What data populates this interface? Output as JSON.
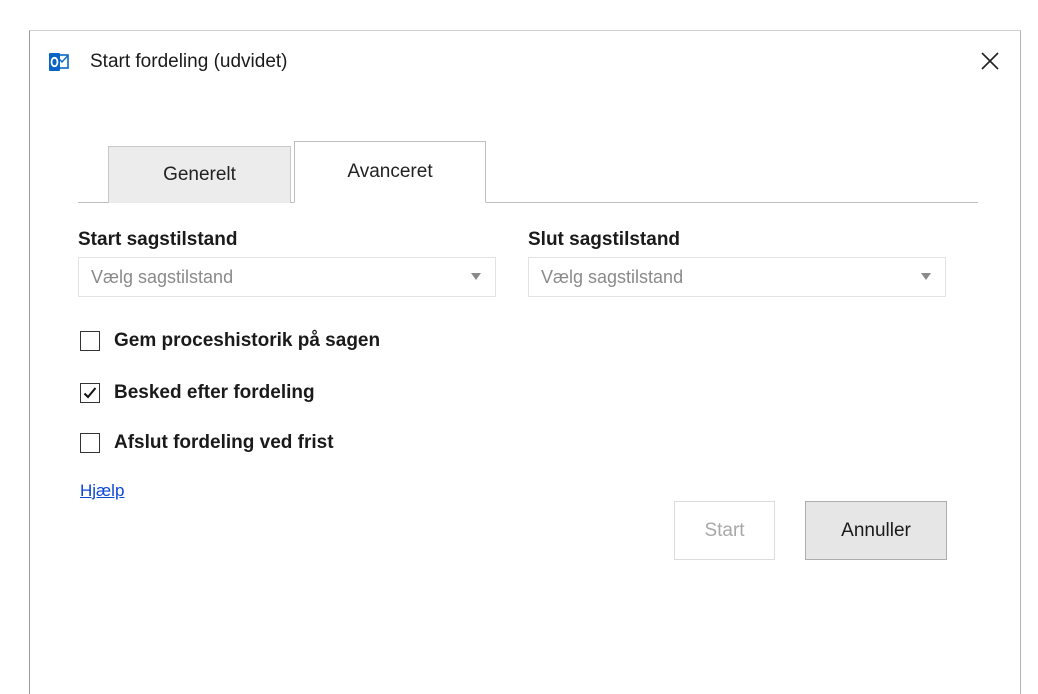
{
  "window": {
    "title": "Start fordeling (udvidet)",
    "app_icon": "outlook-icon",
    "close_icon": "close-icon"
  },
  "tabs": [
    {
      "label": "Generelt",
      "active": false
    },
    {
      "label": "Avanceret",
      "active": true
    }
  ],
  "fields": {
    "start_state": {
      "label": "Start sagstilstand",
      "placeholder": "Vælg sagstilstand"
    },
    "end_state": {
      "label": "Slut sagstilstand",
      "placeholder": "Vælg sagstilstand"
    }
  },
  "options": [
    {
      "label": "Gem proceshistorik på sagen",
      "checked": false
    },
    {
      "label": "Besked efter fordeling",
      "checked": true
    },
    {
      "label": "Afslut fordeling ved frist",
      "checked": false
    }
  ],
  "help_link": "Hjælp",
  "buttons": {
    "start": {
      "label": "Start",
      "enabled": false
    },
    "cancel": {
      "label": "Annuller",
      "enabled": true
    }
  },
  "colors": {
    "outlook_blue": "#0a64c8",
    "link": "#0b46d8",
    "disabled_text": "#a8a8a8"
  }
}
